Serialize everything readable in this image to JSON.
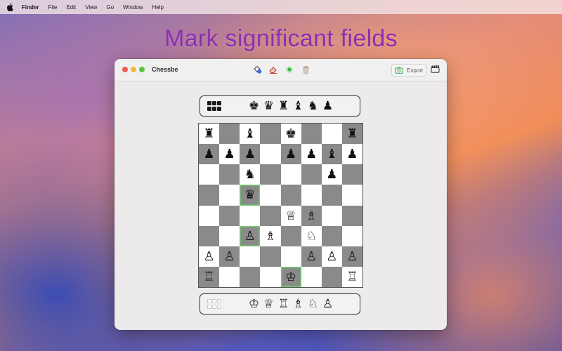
{
  "menubar": {
    "app_name": "Finder",
    "menus": [
      "File",
      "Edit",
      "View",
      "Go",
      "Window",
      "Help"
    ]
  },
  "headline": "Mark significant fields",
  "window": {
    "title": "Chessbe",
    "toolbar": {
      "tools": [
        "paint-bucket-icon",
        "eraser-icon",
        "green-dot-icon",
        "trash-icon"
      ],
      "export_label": "Export"
    }
  },
  "captured_top": [
    "♚",
    "♛",
    "♜",
    "♝",
    "♞",
    "♟"
  ],
  "captured_bottom": [
    "♔",
    "♕",
    "♖",
    "♗",
    "♘",
    "♙"
  ],
  "board": {
    "rows": [
      [
        "♜",
        "",
        "♝",
        "",
        "♚",
        "",
        "",
        "♜"
      ],
      [
        "♟",
        "♟",
        "♟",
        "",
        "♟",
        "♟",
        "♝",
        "♟"
      ],
      [
        "",
        "",
        "♞",
        "",
        "",
        "",
        "♟",
        ""
      ],
      [
        "",
        "",
        "♛",
        "",
        "",
        "",
        "",
        ""
      ],
      [
        "",
        "",
        "",
        "",
        "♕",
        "♗",
        "",
        ""
      ],
      [
        "",
        "",
        "♙",
        "♗",
        "",
        "♘",
        "",
        ""
      ],
      [
        "♙",
        "♙",
        "",
        "",
        "",
        "♙",
        "♙",
        "♙"
      ],
      [
        "♖",
        "",
        "",
        "",
        "♔",
        "",
        "",
        "♖"
      ]
    ],
    "marked_squares": [
      "c5",
      "c3",
      "e1"
    ],
    "colors": {
      "dark": "#8a8a8a",
      "light": "#ffffff",
      "mark": "#6fd06a"
    }
  }
}
